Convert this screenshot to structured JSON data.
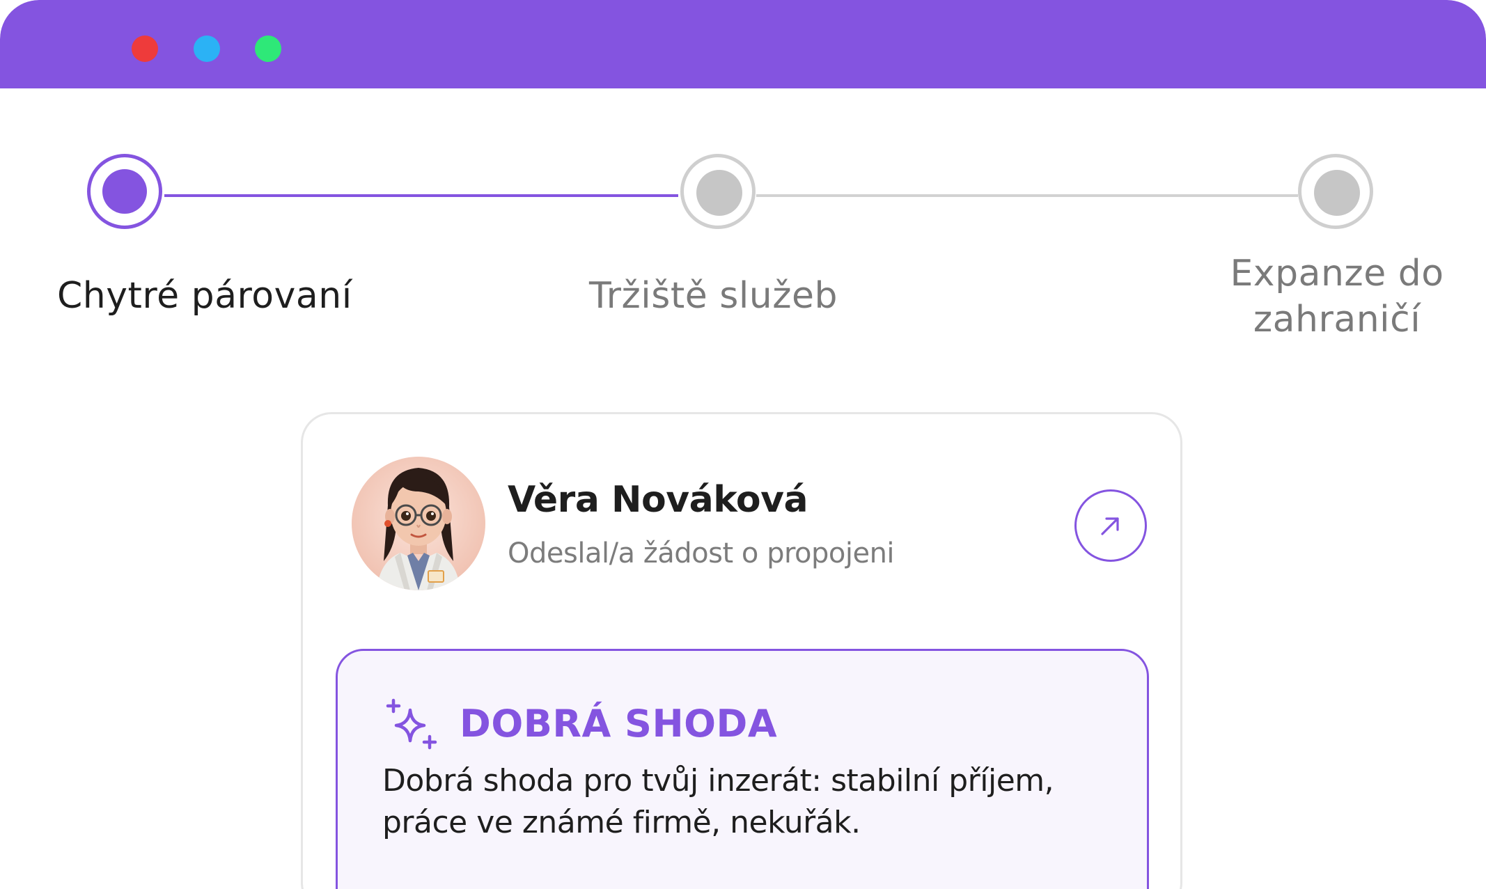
{
  "window": {
    "controls": [
      "close",
      "minimize",
      "maximize"
    ],
    "colors": {
      "accent": "#8454E0",
      "close": "#EE3B3B",
      "minimize": "#2BB2F5",
      "maximize": "#2EE878"
    }
  },
  "stepper": {
    "steps": [
      {
        "label": "Chytré párovaní",
        "state": "active"
      },
      {
        "label": "Tržiště služeb",
        "state": "inactive"
      },
      {
        "label_line1": "Expanze do",
        "label_line2": "zahraničí",
        "state": "inactive"
      }
    ]
  },
  "card": {
    "name": "Věra Nováková",
    "status": "Odeslal/a žádost o propojeni",
    "open_icon": "arrow-up-right-icon",
    "avatar_icon": "user-avatar",
    "match": {
      "icon": "sparkles-icon",
      "title": "DOBRÁ SHODA",
      "text": "Dobrá shoda pro tvůj inzerát: stabilní příjem, práce ve známé firmě, nekuřák."
    }
  }
}
